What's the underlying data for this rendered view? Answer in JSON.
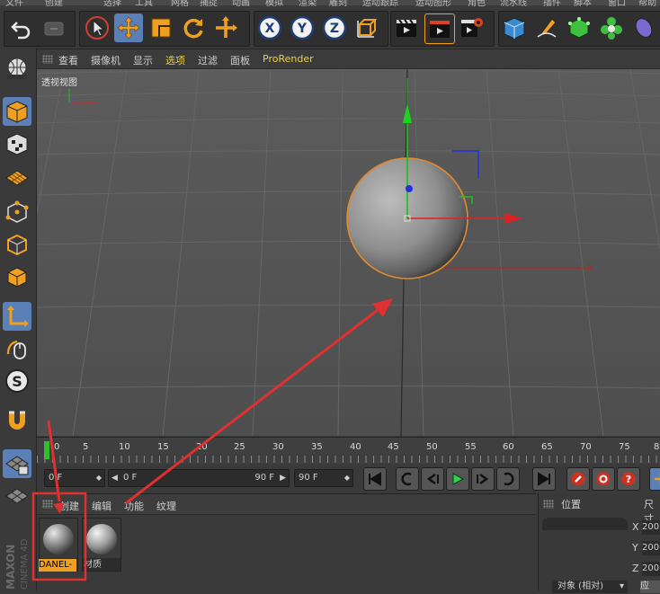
{
  "menu_strip": [
    "文件",
    "编辑",
    "创建",
    "选择",
    "工具",
    "网格",
    "捕捉",
    "动画",
    "模拟",
    "渲染",
    "雕刻",
    "运动跟踪",
    "运动图形",
    "角色",
    "流水线",
    "插件",
    "脚本",
    "窗口",
    "帮助"
  ],
  "viewport": {
    "menu": [
      "查看",
      "摄像机",
      "显示",
      "选项",
      "过滤",
      "面板",
      "ProRender"
    ],
    "active_menu_index": 3,
    "label": "透视视图"
  },
  "timeline": {
    "ticks": [
      "0",
      "5",
      "10",
      "15",
      "20",
      "25",
      "30",
      "35",
      "40",
      "45",
      "50",
      "55",
      "60",
      "65",
      "70",
      "75",
      "8"
    ],
    "current_frame": "0 F",
    "range_start": "0 F",
    "range_end": "90 F",
    "max_frame": "90 F"
  },
  "material_manager": {
    "menu": [
      "创建",
      "编辑",
      "功能",
      "纹理"
    ],
    "materials": [
      {
        "name": "DANEL-",
        "selected": true
      },
      {
        "name": "材质",
        "selected": false
      }
    ]
  },
  "coordinates": {
    "title": "位置",
    "size_label": "尺寸",
    "axes": [
      "X",
      "Y",
      "Z"
    ],
    "values": [
      "200",
      "200",
      "200"
    ],
    "mode": "对象 (相对)",
    "apply_label": "应"
  },
  "brand": {
    "line1": "MAXON",
    "line2": "CINEMA 4D"
  },
  "colors": {
    "selected_material_label": "#f0a020",
    "annotation_red": "#e03030",
    "active_tool": "#5b7fb7",
    "axis_x": "#e02020",
    "axis_y": "#20c020",
    "axis_z": "#2030e0"
  }
}
